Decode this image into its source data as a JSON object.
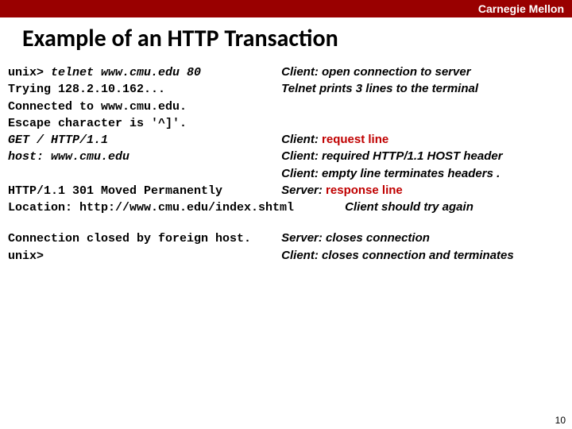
{
  "header": {
    "brand": "Carnegie Mellon"
  },
  "title": "Example of an HTTP Transaction",
  "lines": {
    "l1_code": "unix> ",
    "l1_cmd": "telnet www.cmu.edu 80",
    "l1_ann": "Client: open connection to server",
    "l2_code": "Trying 128.2.10.162...",
    "l2_ann": "Telnet prints 3 lines to the terminal",
    "l3_code": "Connected to www.cmu.edu.",
    "l4_code": "Escape character is '^]'.",
    "l5_code": "GET / HTTP/1.1",
    "l5_ann_pre": "Client: ",
    "l5_ann_red": "request line",
    "l6_code": "host: www.cmu.edu",
    "l6_ann": "Client: required HTTP/1.1 HOST header",
    "l7_ann": "Client: empty line terminates headers .",
    "l8_code": "HTTP/1.1 301 Moved Permanently",
    "l8_ann_pre": "Server: ",
    "l8_ann_red": "response line",
    "l9_code": "Location: http://www.cmu.edu/index.shtml",
    "l9_ann": "Client should try again",
    "l10_code": "Connection closed by foreign host.",
    "l10_ann": "Server: closes connection",
    "l11_code": "unix>",
    "l11_ann": "Client: closes connection and terminates"
  },
  "page_number": "10"
}
